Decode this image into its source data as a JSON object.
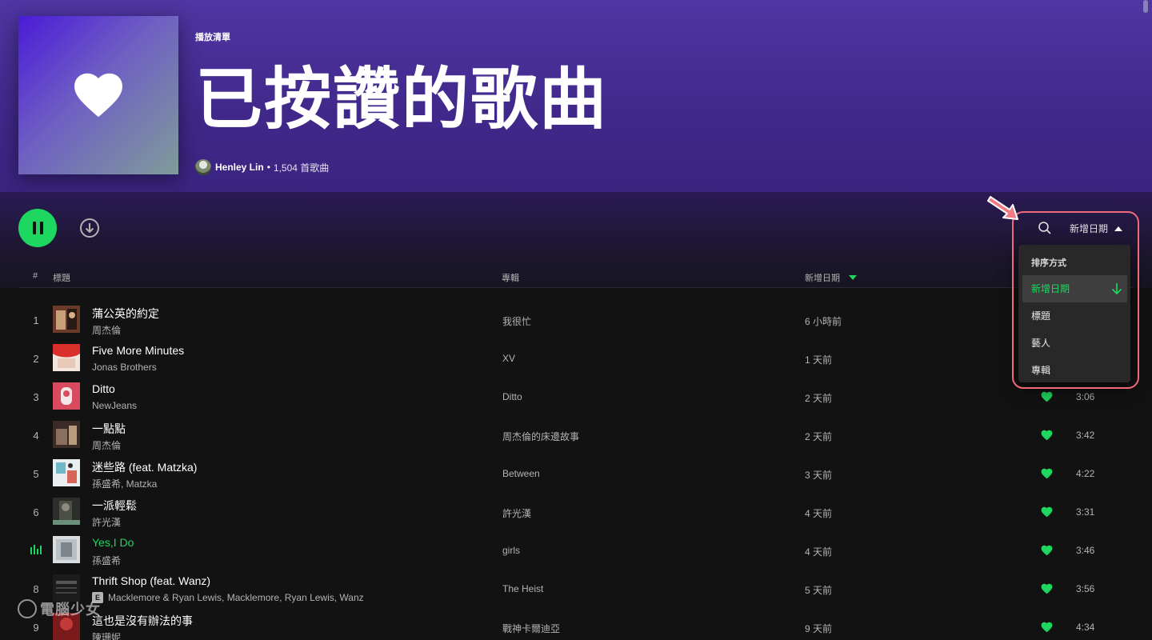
{
  "header": {
    "type_label": "播放清單",
    "title": "已按讚的歌曲",
    "owner": "Henley Lin",
    "separator": "•",
    "song_count": "1,504 首歌曲"
  },
  "columns": {
    "number": "#",
    "title": "標題",
    "album": "專輯",
    "added": "新增日期"
  },
  "toolbar": {
    "sort_label": "新增日期"
  },
  "dropdown": {
    "header": "排序方式",
    "options": [
      "新增日期",
      "標題",
      "藝人",
      "專輯"
    ]
  },
  "tracks": [
    {
      "num": "1",
      "title": "蒲公英的約定",
      "artist": "周杰倫",
      "album": "我很忙",
      "added": "6 小時前",
      "duration": ""
    },
    {
      "num": "2",
      "title": "Five More Minutes",
      "artist": "Jonas Brothers",
      "album": "XV",
      "added": "1 天前",
      "duration": ""
    },
    {
      "num": "3",
      "title": "Ditto",
      "artist": "NewJeans",
      "album": "Ditto",
      "added": "2 天前",
      "duration": "3:06"
    },
    {
      "num": "4",
      "title": "一點點",
      "artist": "周杰倫",
      "album": "周杰倫的床邊故事",
      "added": "2 天前",
      "duration": "3:42"
    },
    {
      "num": "5",
      "title": "迷些路 (feat. Matzka)",
      "artist": "孫盛希, Matzka",
      "album": "Between",
      "added": "3 天前",
      "duration": "4:22"
    },
    {
      "num": "6",
      "title": "一派輕鬆",
      "artist": "許光漢",
      "album": "許光漢",
      "added": "4 天前",
      "duration": "3:31"
    },
    {
      "num": "",
      "title": "Yes,I Do",
      "artist": "孫盛希",
      "album": "girls",
      "added": "4 天前",
      "duration": "3:46"
    },
    {
      "num": "8",
      "title": "Thrift Shop (feat. Wanz)",
      "explicit": "E",
      "artist": "Macklemore & Ryan Lewis, Macklemore, Ryan Lewis, Wanz",
      "album": "The Heist",
      "added": "5 天前",
      "duration": "3:56"
    },
    {
      "num": "9",
      "title": "這也是沒有辦法的事",
      "artist": "陳珊妮",
      "album": "戰神卡爾迪亞",
      "added": "9 天前",
      "duration": "4:34"
    }
  ],
  "watermark": "電腦少女",
  "colors": {
    "accent": "#1ed760",
    "header_bg": "#4f36a3",
    "highlight": "#f06b7a"
  }
}
